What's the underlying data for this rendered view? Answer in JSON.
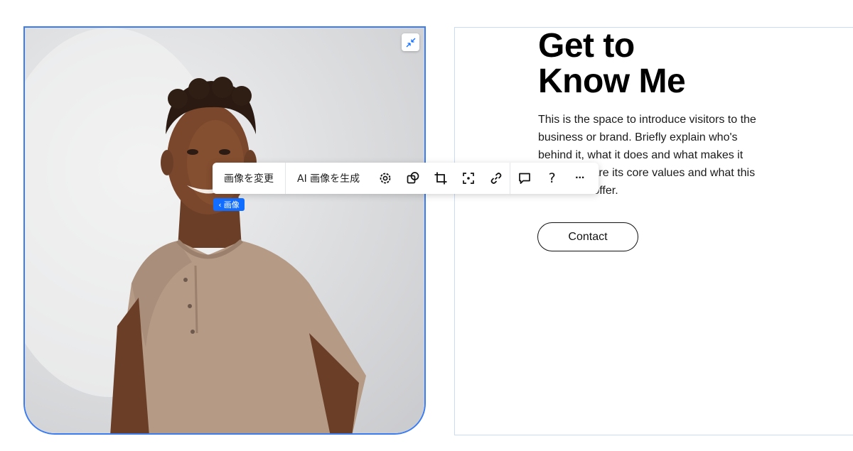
{
  "section": {
    "title_line1": "Get to",
    "title_line2": "Know Me",
    "body": "This is the space to introduce visitors to the business or brand. Briefly explain who's behind it, what it does and what makes it unique. Share its core values and what this site has to offer.",
    "contact_label": "Contact"
  },
  "toolbar": {
    "change_image": "画像を変更",
    "generate_ai": "AI 画像を生成",
    "icons": [
      "settings-icon",
      "mask-shape-icon",
      "crop-icon",
      "focal-point-icon",
      "link-icon",
      "comment-icon",
      "help-icon",
      "more-icon"
    ],
    "help_glyph": "?",
    "more_glyph": "···"
  },
  "image_tag": {
    "arrow": "‹",
    "label": "画像"
  },
  "colors": {
    "selection": "#3b7cf0",
    "accent": "#116dff",
    "panel_border": "#c9dcf6"
  }
}
